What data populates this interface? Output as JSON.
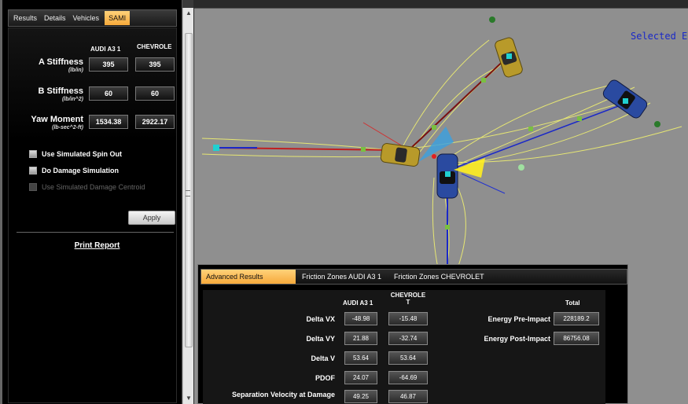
{
  "tabs": [
    "Results",
    "Details",
    "Vehicles",
    "SAMI"
  ],
  "sami": {
    "col_headers": [
      "AUDI A3 1",
      "CHEVROLE"
    ],
    "rows": [
      {
        "label": "A Stiffness",
        "unit": "(lb/in)",
        "v1": "395",
        "v2": "395"
      },
      {
        "label": "B Stiffness",
        "unit": "(lb/in^2)",
        "v1": "60",
        "v2": "60"
      },
      {
        "label": "Yaw Moment",
        "unit": "(lb-sec^2-ft)",
        "v1": "1534.38",
        "v2": "2922.17"
      }
    ],
    "checkboxes": [
      {
        "label": "Use Simulated Spin Out",
        "checked": false,
        "enabled": true
      },
      {
        "label": "Do Damage Simulation",
        "checked": false,
        "enabled": true
      },
      {
        "label": "Use Simulated Damage Centroid",
        "checked": false,
        "enabled": false
      }
    ],
    "apply_label": "Apply",
    "print_label": "Print Report"
  },
  "viewport": {
    "selected_text": "Selected E",
    "background": "#8f8f8f"
  },
  "advanced": {
    "tabs": [
      "Advanced Results",
      "Friction Zones AUDI A3 1",
      "Friction Zones CHEVROLET"
    ],
    "col1": "AUDI A3 1",
    "col2_line1": "CHEVROLE",
    "col2_line2": "T",
    "total_header": "Total",
    "rows": [
      {
        "label": "Delta VX",
        "v1": "-48.98",
        "v2": "-15.48"
      },
      {
        "label": "Delta VY",
        "v1": "21.88",
        "v2": "-32.74"
      },
      {
        "label": "Delta V",
        "v1": "53.64",
        "v2": "53.64"
      },
      {
        "label": "PDOF",
        "v1": "24.07",
        "v2": "-64.69"
      },
      {
        "label": "Separation Velocity at Damage",
        "v1": "49.25",
        "v2": "46.87"
      }
    ],
    "totals": [
      {
        "label": "Energy Pre-Impact",
        "value": "228189.2"
      },
      {
        "label": "Energy Post-Impact",
        "value": "86756.08"
      }
    ]
  },
  "colors": {
    "accent_tab": "#f6a93b",
    "audi_car": "#b89a2a",
    "chevrolet_car": "#2a4aa0",
    "trajectory": "#f0f070"
  }
}
